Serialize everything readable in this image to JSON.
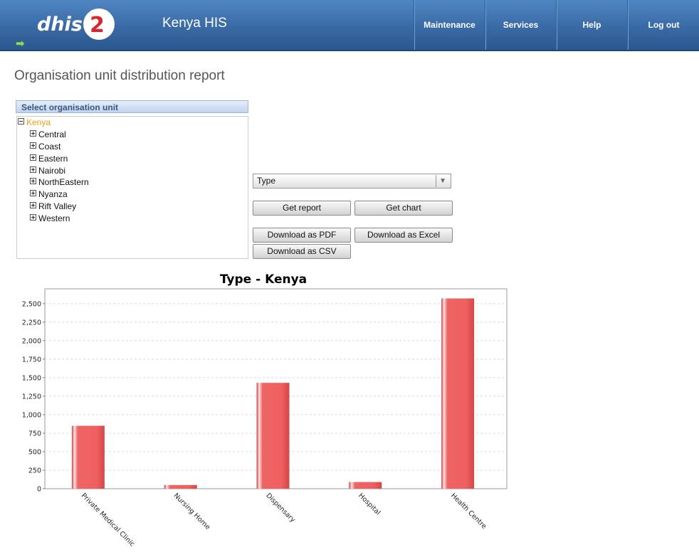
{
  "header": {
    "logo_text": "dhis2",
    "app_title": "Kenya HIS",
    "menu": [
      {
        "label": "Maintenance"
      },
      {
        "label": "Services"
      },
      {
        "label": "Help"
      },
      {
        "label": "Log out"
      }
    ],
    "colors": {
      "header_top": "#4f86c2",
      "header_bottom": "#2a578e",
      "logo_red": "#d7262c"
    }
  },
  "page": {
    "title": "Organisation unit distribution report"
  },
  "org_tree": {
    "header": "Select organisation unit",
    "root": {
      "label": "Kenya",
      "color": "#f39c12",
      "expanded": true
    },
    "children": [
      {
        "label": "Central"
      },
      {
        "label": "Coast"
      },
      {
        "label": "Eastern"
      },
      {
        "label": "Nairobi"
      },
      {
        "label": "NorthEastern"
      },
      {
        "label": "Nyanza"
      },
      {
        "label": "Rift Valley"
      },
      {
        "label": "Western"
      }
    ]
  },
  "controls": {
    "groupset_select": {
      "selected": "Type"
    },
    "buttons": {
      "get_report": "Get report",
      "get_chart": "Get chart",
      "download_pdf": "Download as PDF",
      "download_excel": "Download as Excel",
      "download_csv": "Download as CSV"
    }
  },
  "chart_data": {
    "type": "bar",
    "title": "Type - Kenya",
    "categories": [
      "Private Medical Clinic",
      "Nursing Home",
      "Dispensary",
      "Hospital",
      "Health Centre"
    ],
    "values": [
      850,
      50,
      1430,
      90,
      2570
    ],
    "ylim": [
      0,
      2700
    ],
    "yticks": [
      0,
      250,
      500,
      750,
      1000,
      1250,
      1500,
      1750,
      2000,
      2250,
      2500
    ],
    "ytick_labels": [
      "0",
      "250",
      "500",
      "750",
      "1,000",
      "1,250",
      "1,500",
      "1,750",
      "2,000",
      "2,250",
      "2,500"
    ],
    "bar_color": "#e85454",
    "grid": true,
    "xlabel": "",
    "ylabel": ""
  }
}
